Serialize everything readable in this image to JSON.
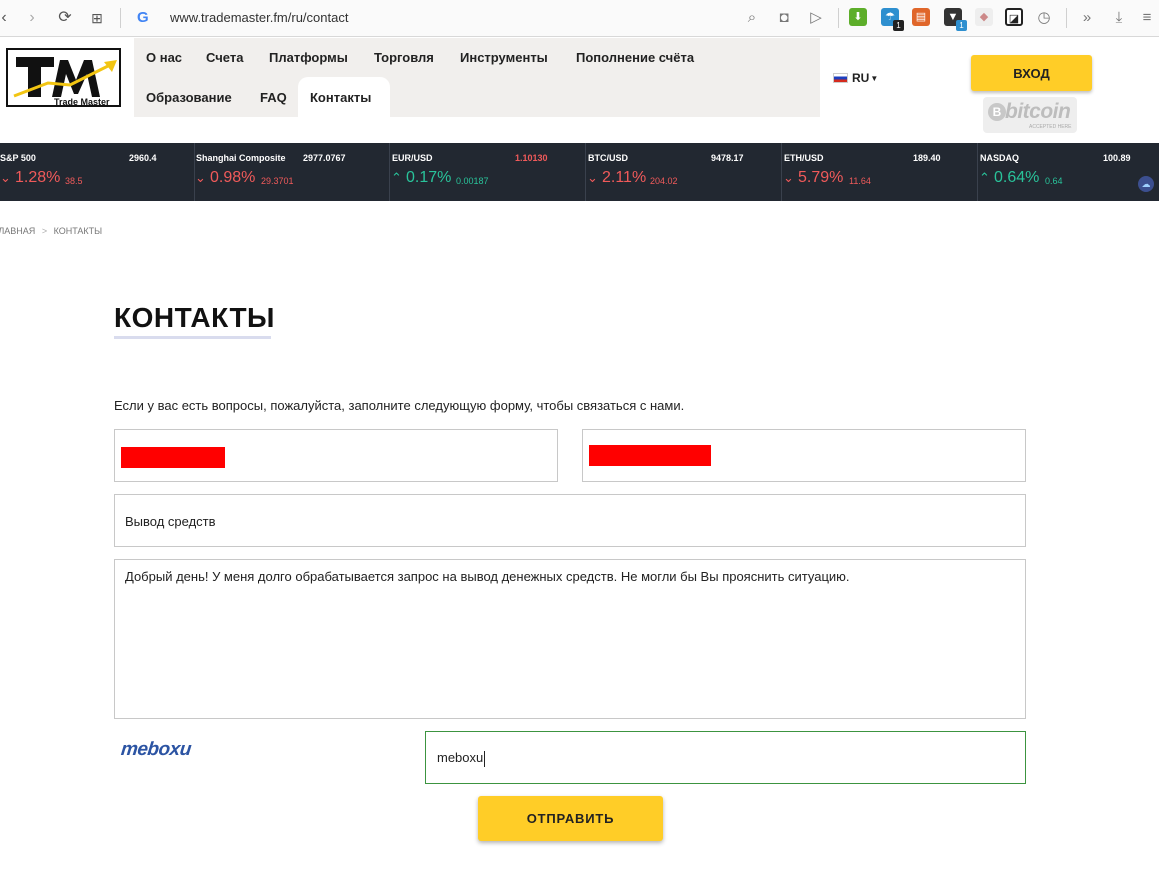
{
  "browser": {
    "url": "www.trademaster.fm/ru/contact",
    "badge_count_1": "1",
    "badge_count_2": "1"
  },
  "site": {
    "logo_text": "Trade Master",
    "menu": [
      {
        "label": "О нас"
      },
      {
        "label": "Счета"
      },
      {
        "label": "Платформы"
      },
      {
        "label": "Торговля"
      },
      {
        "label": "Инструменты"
      },
      {
        "label": "Пополнение счёта"
      },
      {
        "label": "Образование"
      },
      {
        "label": "FAQ"
      },
      {
        "label": "Контакты",
        "active": true
      }
    ],
    "language": "RU",
    "login_label": "ВХОД",
    "bitcoin_badge": {
      "word": "bitcoin",
      "sub": "ACCEPTED HERE"
    }
  },
  "ticker": [
    {
      "name": "S&P 500",
      "price": "2960.4",
      "direction": "down",
      "pct": "1.28%",
      "change": "38.5"
    },
    {
      "name": "Shanghai Composite",
      "price": "2977.0767",
      "direction": "down",
      "pct": "0.98%",
      "change": "29.3701"
    },
    {
      "name": "EUR/USD",
      "price": "1.10130",
      "direction": "up",
      "pct": "0.17%",
      "change": "0.00187"
    },
    {
      "name": "BTC/USD",
      "price": "9478.17",
      "direction": "down",
      "pct": "2.11%",
      "change": "204.02"
    },
    {
      "name": "ETH/USD",
      "price": "189.40",
      "direction": "down",
      "pct": "5.79%",
      "change": "11.64"
    },
    {
      "name": "NASDAQ",
      "price": "100.89",
      "direction": "up",
      "pct": "0.64%",
      "change": "0.64"
    }
  ],
  "breadcrumb": {
    "home": "ГЛАВНАЯ",
    "separator": ">",
    "current": "КОНТАКТЫ"
  },
  "page": {
    "title": "КОНТАКТЫ",
    "intro": "Если у вас есть вопросы, пожалуйста, заполните следующую форму, чтобы связаться с нами.",
    "form": {
      "name_value": "",
      "email_value": "",
      "subject_value": "Вывод средств",
      "message_value": "Добрый день! У меня долго обрабатывается запрос на вывод денежных средств. Не могли бы Вы прояснить ситуацию.",
      "captcha_image_text": "meboxu",
      "captcha_value": "meboxu",
      "submit_label": "ОТПРАВИТЬ"
    }
  },
  "colors": {
    "accent_yellow": "#ffcd27",
    "ticker_bg": "#222831",
    "down": "#f05a5a",
    "up": "#29c39a",
    "redaction": "#ff0000"
  }
}
